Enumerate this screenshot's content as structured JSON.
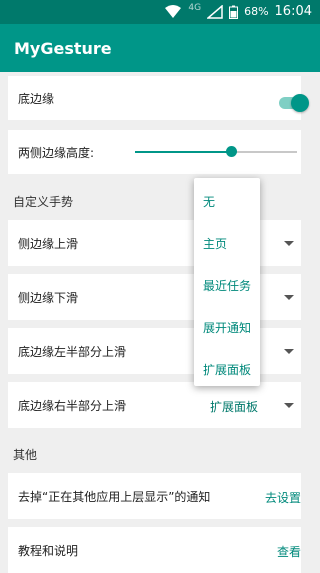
{
  "status_bar": {
    "network": "4G",
    "battery": "68%",
    "time": "16:04",
    "icons": [
      "wifi-icon",
      "signal-icon",
      "battery-icon"
    ]
  },
  "app_bar": {
    "title": "MyGesture"
  },
  "settings": {
    "bottom_edge": {
      "label": "底边缘",
      "enabled": true
    },
    "side_edge_height": {
      "label": "两侧边缘高度:",
      "value_fraction": 0.59
    }
  },
  "custom_gestures": {
    "section_title": "自定义手势",
    "items": [
      {
        "label": "侧边缘上滑",
        "value": ""
      },
      {
        "label": "侧边缘下滑",
        "value": ""
      },
      {
        "label": "底边缘左半部分上滑",
        "value": ""
      },
      {
        "label": "底边缘右半部分上滑",
        "value": "扩展面板"
      }
    ]
  },
  "popup_menu": {
    "options": [
      "无",
      "主页",
      "最近任务",
      "展开通知",
      "扩展面板"
    ]
  },
  "other": {
    "section_title": "其他",
    "items": [
      {
        "label": "去掉“正在其他应用上层显示”的通知",
        "action": "去设置"
      },
      {
        "label": "教程和说明",
        "action": "查看"
      }
    ]
  },
  "colors": {
    "primary": "#009688",
    "primary_dark": "#00796b",
    "accent": "#00897b"
  }
}
